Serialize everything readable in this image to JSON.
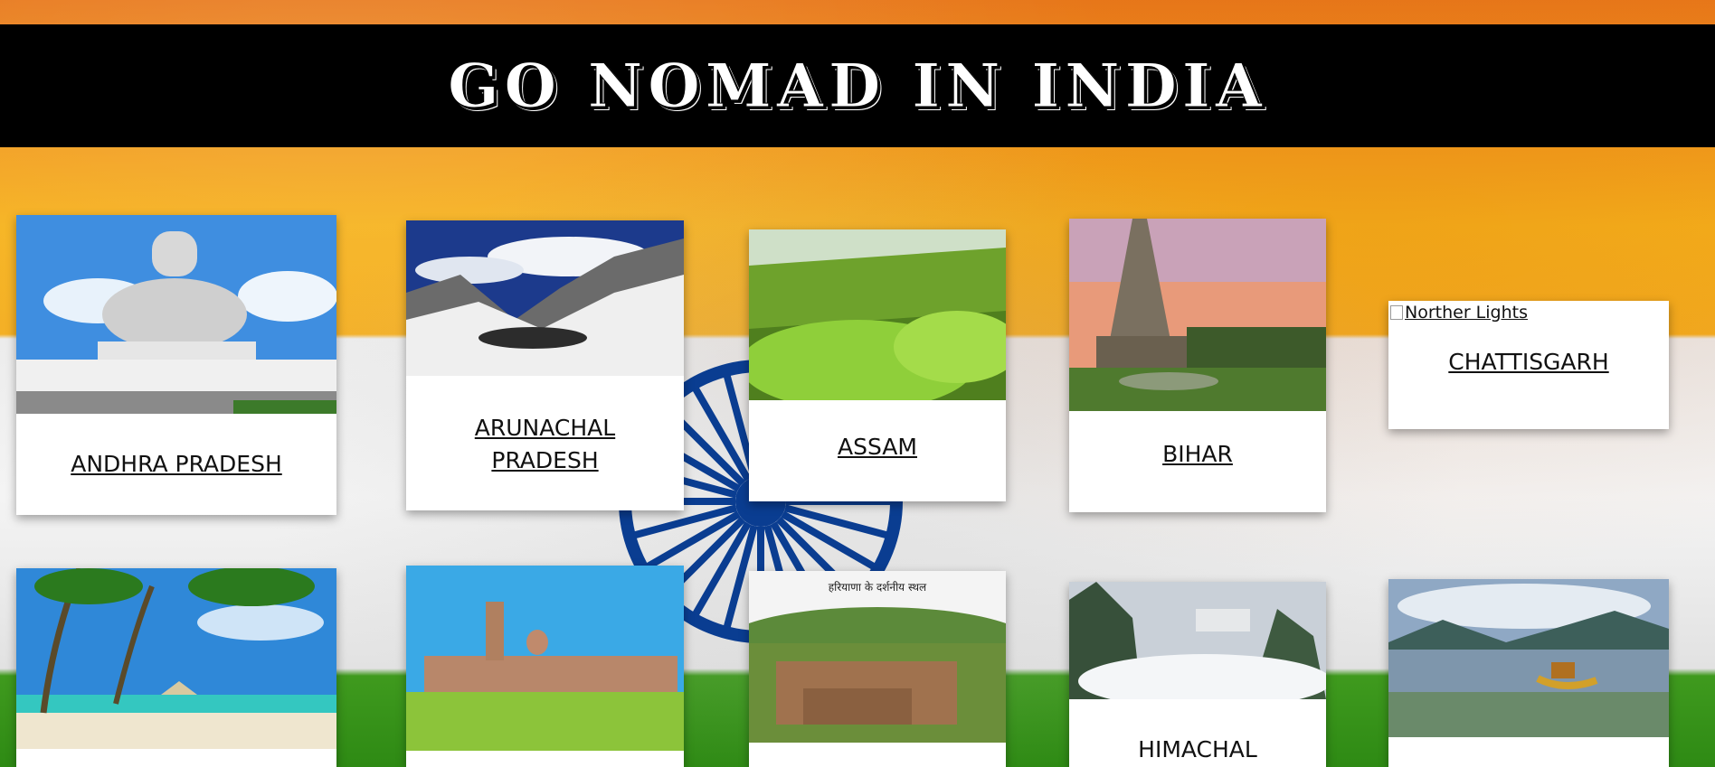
{
  "site": {
    "title": "GO NOMAD IN INDIA"
  },
  "states": [
    {
      "name": "ANDHRA PRADESH",
      "scene": "buddha-statue"
    },
    {
      "name": "ARUNACHAL PRADESH",
      "scene": "snow-mountains"
    },
    {
      "name": "ASSAM",
      "scene": "tea-garden"
    },
    {
      "name": "BIHAR",
      "scene": "temple-sunset"
    },
    {
      "name": "CHATTISGARH",
      "image_alt": "Norther Lights",
      "image_broken": true
    },
    {
      "name": "",
      "scene": "palm-beach"
    },
    {
      "name": "",
      "scene": "palace"
    },
    {
      "name": "",
      "scene": "fort",
      "image_caption": "हरियाणा के दर्शनीय स्थल"
    },
    {
      "name": "HIMACHAL",
      "scene": "snowy-hills"
    },
    {
      "name": "",
      "scene": "lake-shikara"
    }
  ],
  "colors": {
    "saffron": "#f4a020",
    "white": "#f2f2f2",
    "green": "#2e8a14",
    "chakra": "#0a3d91"
  }
}
